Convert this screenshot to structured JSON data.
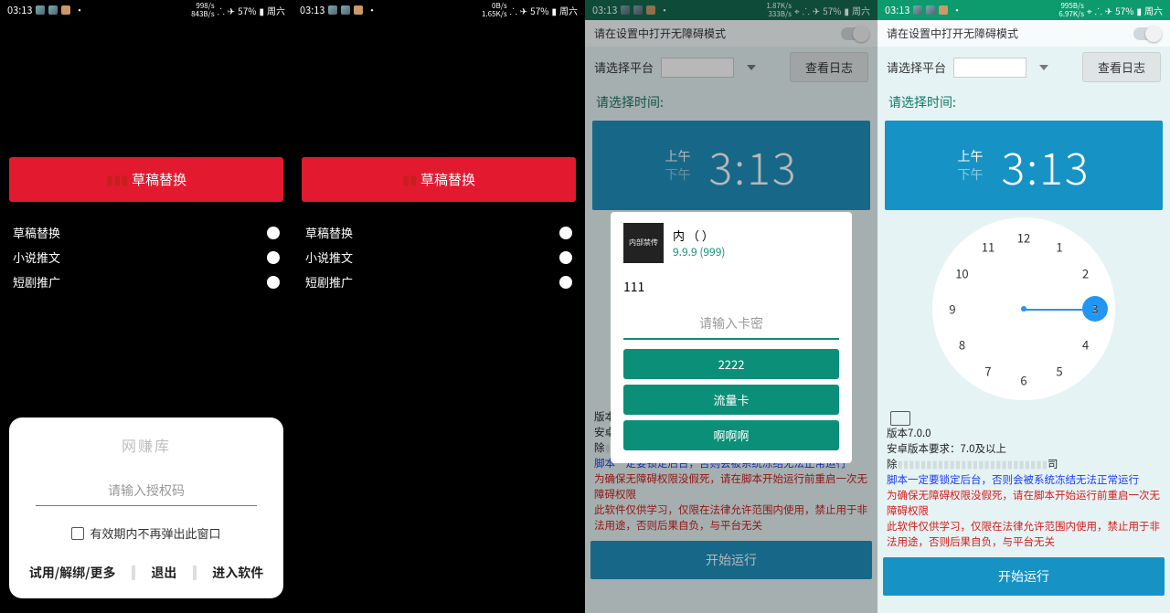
{
  "status": {
    "time": "03:13",
    "battery": "57%",
    "day": "周六",
    "rates": {
      "s1_up": "998/s",
      "s1_dn": "843B/s",
      "s2_up": "0B/s",
      "s2_dn": "1.65K/s",
      "s3_up": "1.87K/s",
      "s3_dn": "333B/s",
      "s4_up": "995B/s",
      "s4_dn": "6.97K/s"
    }
  },
  "red_button_label": "草稿替换",
  "list_items": [
    "草稿替换",
    "小说推文",
    "短剧推广"
  ],
  "auth_popup": {
    "title": "网赚库",
    "placeholder": "请输入授权码",
    "checkbox": "有效期内不再弹出此窗口",
    "btn1": "试用/解绑/更多",
    "btn2": "退出",
    "btn3": "进入软件"
  },
  "card_popup": {
    "avatar_text": "内部禁传",
    "title": "内            （            ）",
    "version": "9.9.9 (999)",
    "body": "111",
    "placeholder": "请输入卡密",
    "btn1": "2222",
    "btn2": "流量卡",
    "btn3": "啊啊啊"
  },
  "config": {
    "accessibility_tip": "请在设置中打开无障碍模式",
    "platform_label": "请选择平台",
    "log_button": "查看日志",
    "time_title": "请选择时间:",
    "am": "上午",
    "pm": "下午",
    "time": "3:13",
    "knob": "3",
    "version": "版本7.0.0",
    "android_req": "安卓版本要求：7.0及以上",
    "line3_prefix": "除",
    "line3_suffix": "司",
    "blue1": "脚本一定要锁定后台，否则会被系统冻结无法正常运行",
    "red1": "为确保无障碍权限没假死，请在脚本开始运行前重启一次无障碍权限",
    "red2": "此软件仅供学习，仅限在法律允许范围内使用，禁止用于非法用途，否则后果自负，与平台无关",
    "start": "开始运行"
  },
  "clock_labels": {
    "12": "12",
    "1": "1",
    "2": "2",
    "3": "3",
    "4": "4",
    "5": "5",
    "6": "6",
    "7": "7",
    "8": "8",
    "9": "9",
    "10": "10",
    "11": "11"
  }
}
